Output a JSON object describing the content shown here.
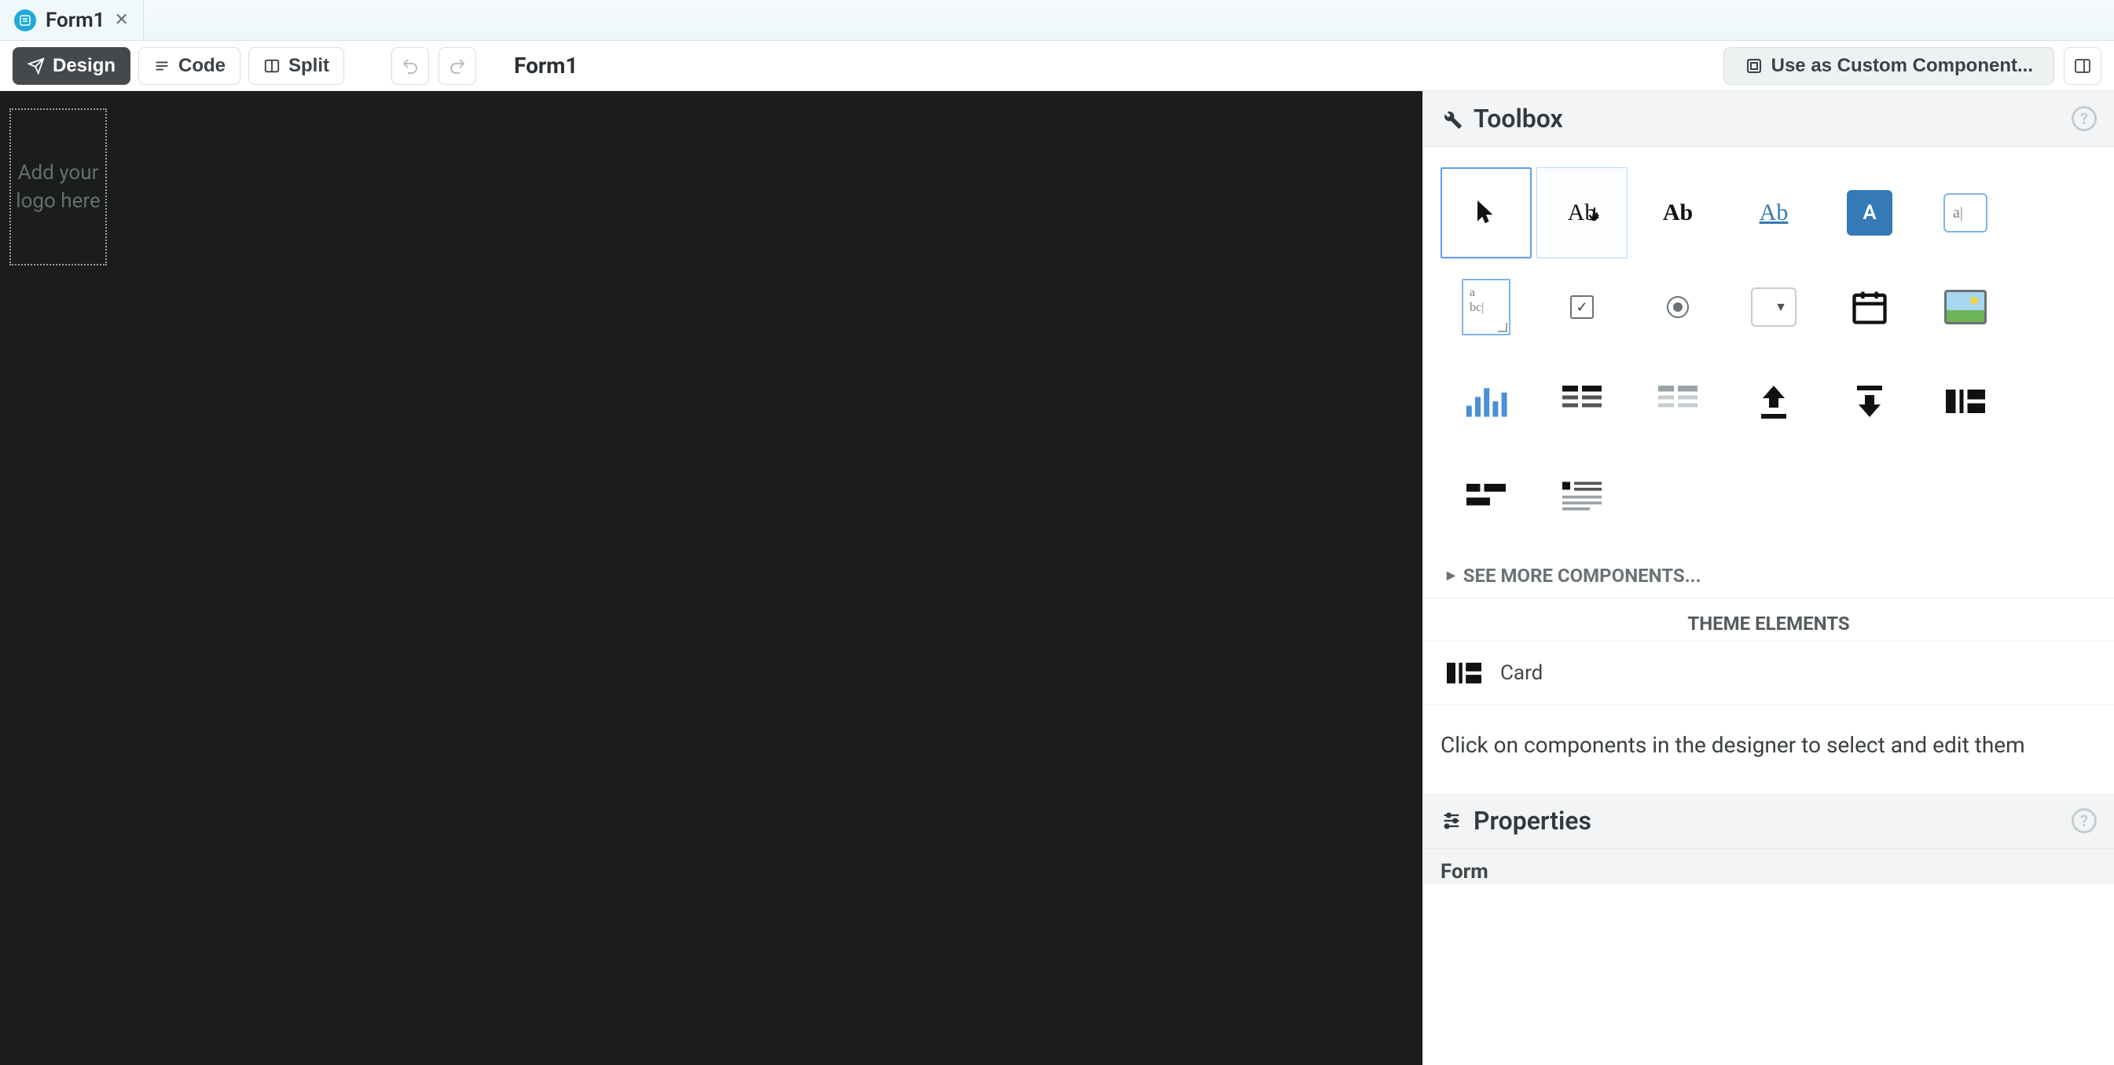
{
  "tab": {
    "title": "Form1"
  },
  "toolbar": {
    "design": "Design",
    "code": "Code",
    "split": "Split",
    "formTitle": "Form1",
    "useAsComponent": "Use as Custom Component..."
  },
  "canvas": {
    "logoPlaceholder": "Add your logo here"
  },
  "toolbox": {
    "title": "Toolbox",
    "seeMore": "SEE MORE COMPONENTS...",
    "themeHeading": "THEME ELEMENTS",
    "card": "Card",
    "hint": "Click on components in the designer to select and edit them",
    "tools": {
      "label": "Ab",
      "heading": "Ab",
      "link": "Ab",
      "button": "A",
      "textbox": "a|",
      "textarea": "a\nbc|",
      "dropdown": "▼"
    }
  },
  "properties": {
    "title": "Properties",
    "selected": "Form"
  }
}
